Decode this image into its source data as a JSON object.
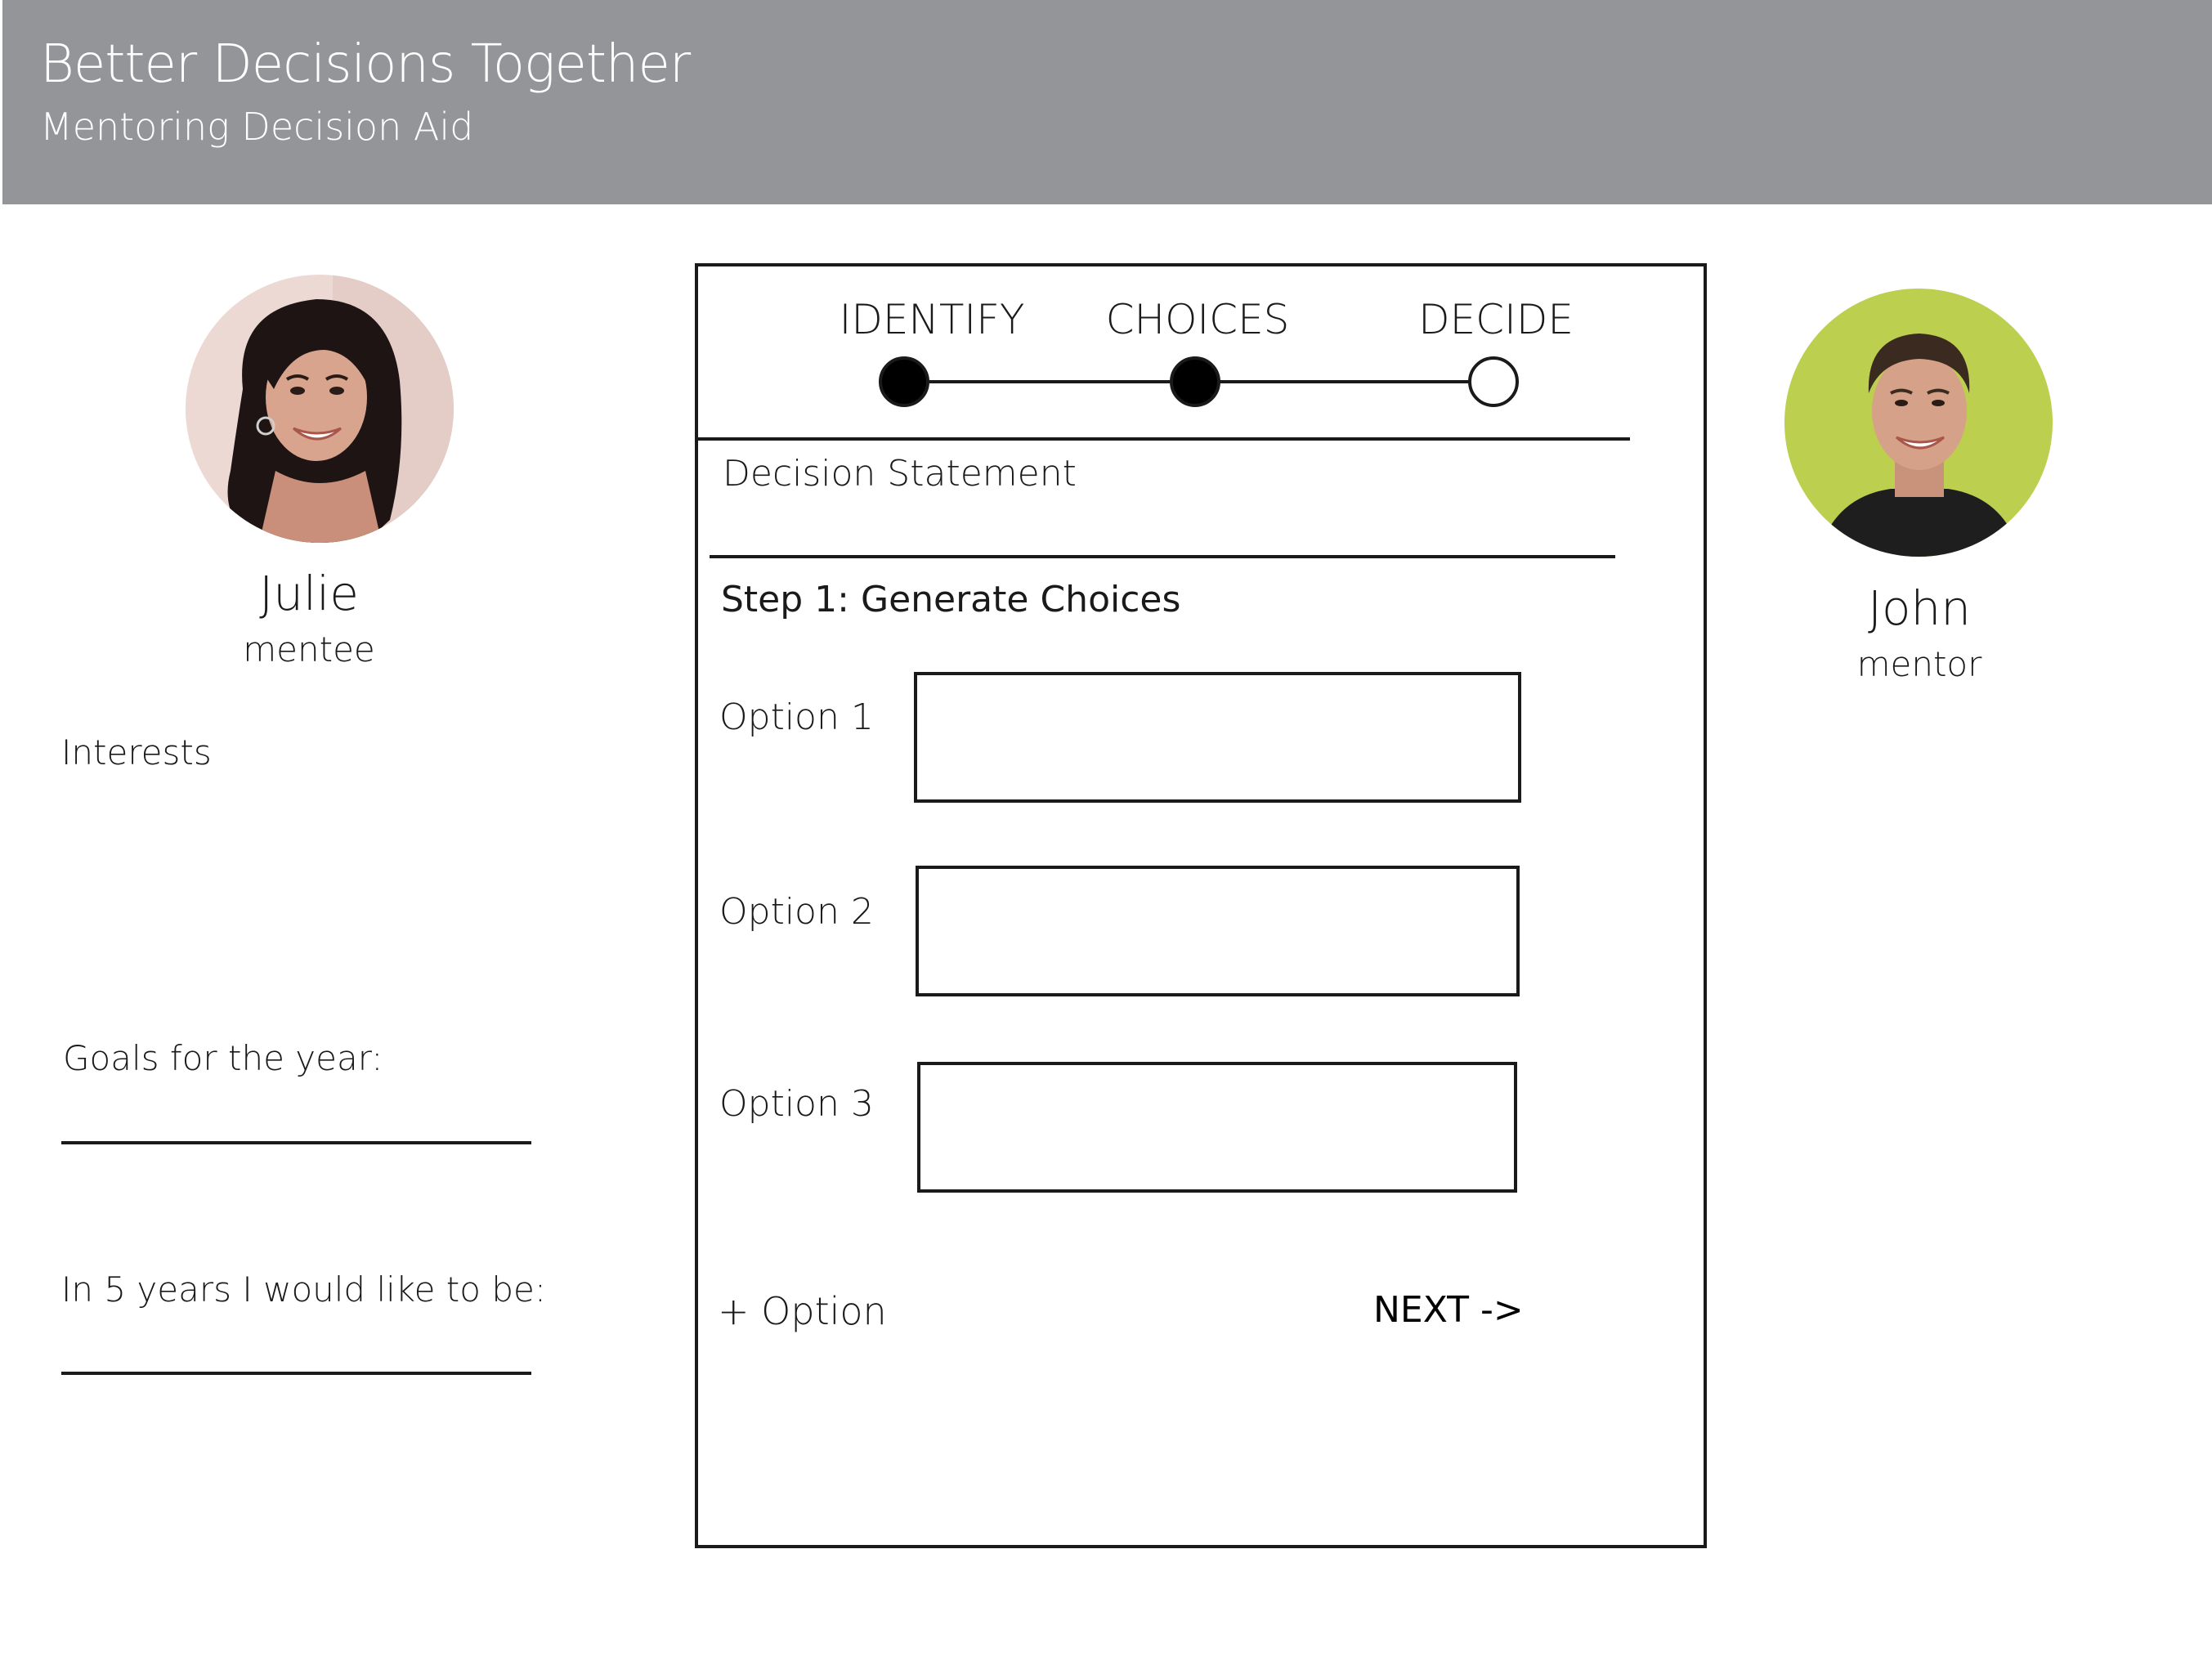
{
  "header": {
    "title": "Better Decisions Together",
    "subtitle": "Mentoring Decision Aid",
    "background_color": "#939598"
  },
  "mentee": {
    "name": "Julie",
    "role": "mentee",
    "avatar_icon": "julie-avatar-photo",
    "interests_label": "Interests",
    "goals_label": "Goals for the year:",
    "future_label": "In 5 years I would like to be:"
  },
  "mentor": {
    "name": "John",
    "role": "mentor",
    "avatar_icon": "john-avatar-photo",
    "avatar_background": "#bccf4e"
  },
  "progress": {
    "steps": [
      {
        "label": "IDENTIFY",
        "completed": true
      },
      {
        "label": "CHOICES",
        "completed": true
      },
      {
        "label": "DECIDE",
        "completed": false
      }
    ]
  },
  "decision": {
    "statement_label": "Decision Statement",
    "step_heading": "Step 1: Generate Choices",
    "options": [
      {
        "label": "Option 1",
        "value": ""
      },
      {
        "label": "Option 2",
        "value": ""
      },
      {
        "label": "Option 3",
        "value": ""
      }
    ],
    "add_option_label": "+ Option",
    "next_label": "NEXT ->"
  }
}
